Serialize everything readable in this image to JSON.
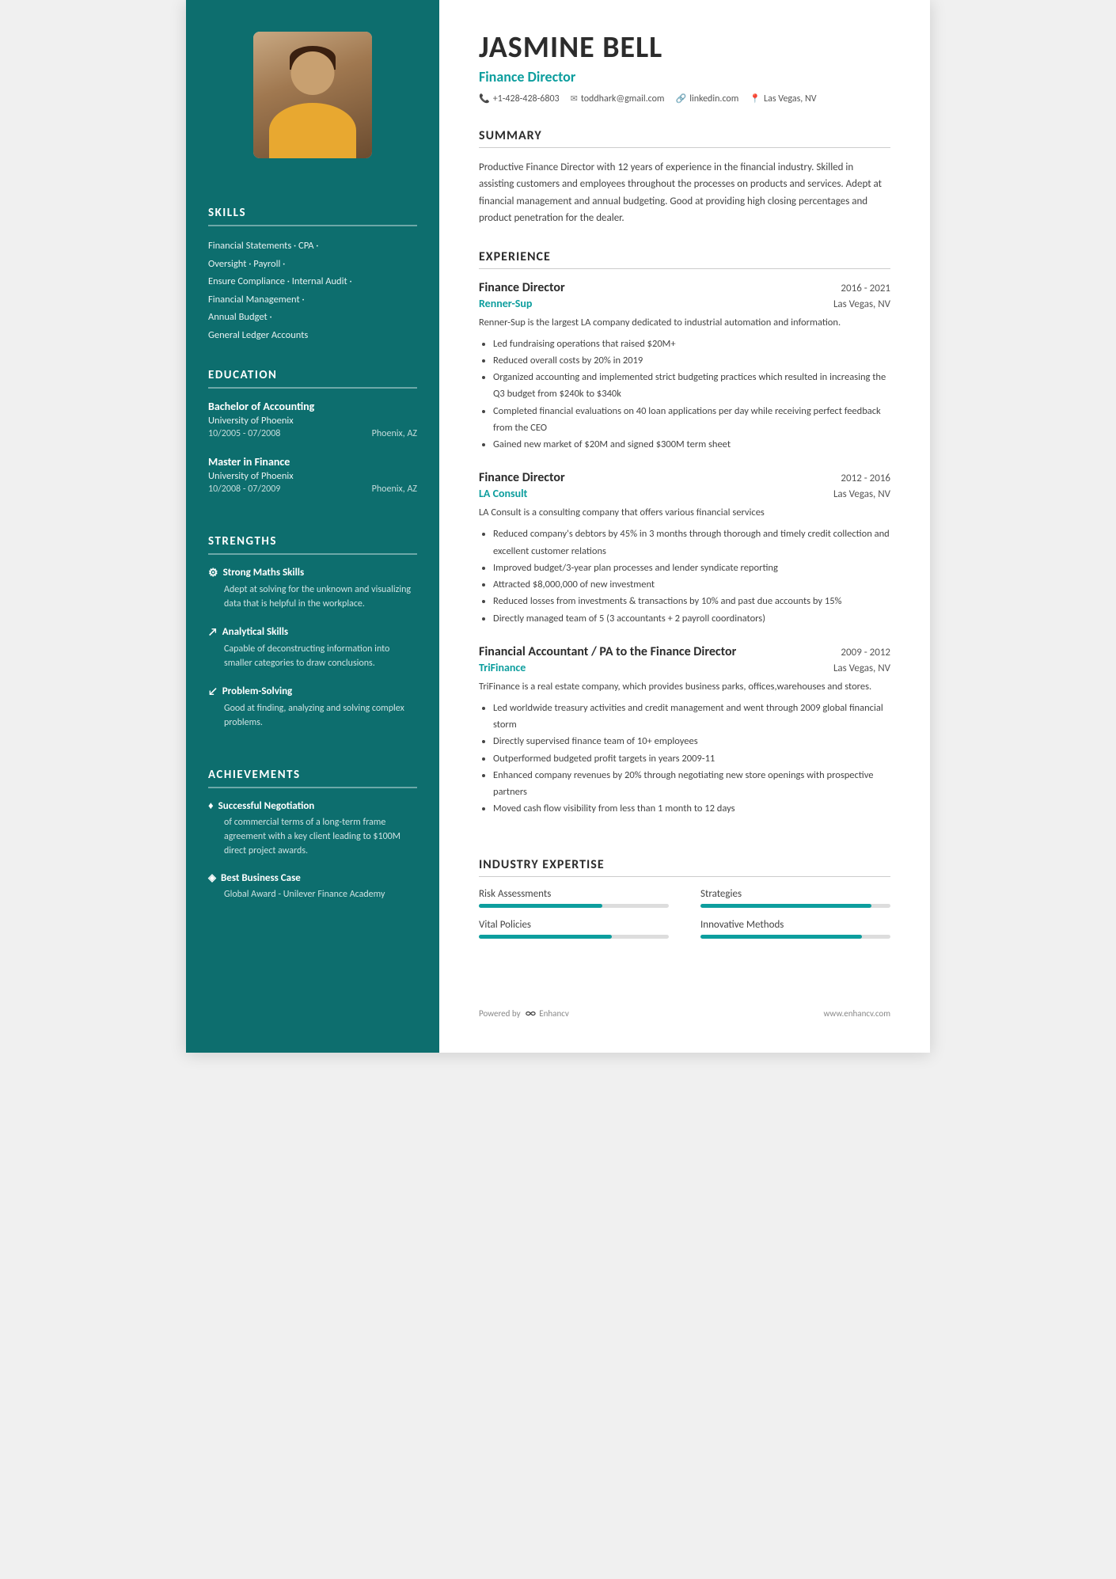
{
  "sidebar": {
    "skills_title": "SKILLS",
    "skills": [
      "Financial Statements · CPA ·",
      "Oversight · Payroll ·",
      "Ensure Compliance · Internal Audit ·",
      "Financial Management ·",
      "Annual Budget ·",
      "General Ledger Accounts"
    ],
    "education_title": "EDUCATION",
    "education": [
      {
        "degree": "Bachelor of Accounting",
        "school": "University of Phoenix",
        "dates": "10/2005 - 07/2008",
        "location": "Phoenix, AZ"
      },
      {
        "degree": "Master in Finance",
        "school": "University of Phoenix",
        "dates": "10/2008 - 07/2009",
        "location": "Phoenix, AZ"
      }
    ],
    "strengths_title": "STRENGTHS",
    "strengths": [
      {
        "icon": "⚙",
        "title": "Strong Maths Skills",
        "desc": "Adept at solving for the unknown and visualizing data that is helpful in the workplace."
      },
      {
        "icon": "↗",
        "title": "Analytical Skills",
        "desc": "Capable of deconstructing information into smaller categories to draw conclusions."
      },
      {
        "icon": "↙",
        "title": "Problem-Solving",
        "desc": "Good at finding, analyzing and solving complex problems."
      }
    ],
    "achievements_title": "ACHIEVEMENTS",
    "achievements": [
      {
        "icon": "♦",
        "title": "Successful Negotiation",
        "desc": "of commercial terms of a long-term frame agreement with a key client leading to $100M direct project awards."
      },
      {
        "icon": "◈",
        "title": "Best Business Case",
        "desc": "Global Award - Unilever Finance Academy"
      }
    ]
  },
  "header": {
    "name": "JASMINE BELL",
    "title": "Finance Director",
    "phone": "+1-428-428-6803",
    "email": "toddhark@gmail.com",
    "linkedin": "linkedin.com",
    "location": "Las Vegas, NV"
  },
  "summary": {
    "title": "SUMMARY",
    "text": "Productive Finance Director with 12 years of experience in the financial industry. Skilled in assisting customers and employees throughout the processes on products and services. Adept at financial management and annual budgeting. Good at providing high closing percentages and product penetration for the dealer."
  },
  "experience": {
    "title": "EXPERIENCE",
    "entries": [
      {
        "job_title": "Finance Director",
        "dates": "2016 - 2021",
        "company": "Renner-Sup",
        "location": "Las Vegas, NV",
        "desc": "Renner-Sup is the largest LA company dedicated to industrial automation and information.",
        "bullets": [
          "Led fundraising operations that raised $20M+",
          "Reduced overall costs by 20% in 2019",
          "Organized accounting and implemented strict budgeting practices which resulted in increasing the Q3 budget from $240k to $340k",
          "Completed financial evaluations on 40 loan applications per day while receiving perfect feedback from the CEO",
          "Gained new market of $20M and signed $300M term sheet"
        ]
      },
      {
        "job_title": "Finance Director",
        "dates": "2012 - 2016",
        "company": "LA Consult",
        "location": "Las Vegas, NV",
        "desc": "LA Consult is a consulting company that offers various financial services",
        "bullets": [
          "Reduced company's debtors by 45% in 3 months through thorough and timely credit collection and excellent customer relations",
          "Improved budget/3-year plan processes and lender syndicate reporting",
          "Attracted $8,000,000 of new investment",
          "Reduced losses from investments & transactions by 10% and past due accounts by 15%",
          "Directly managed team of 5 (3 accountants + 2 payroll coordinators)"
        ]
      },
      {
        "job_title": "Financial Accountant / PA to the Finance Director",
        "dates": "2009 - 2012",
        "company": "TriFinance",
        "location": "Las Vegas, NV",
        "desc": "TriFinance is a real estate company, which provides business parks, offices,warehouses and stores.",
        "bullets": [
          "Led worldwide treasury activities and credit management and went through 2009 global financial storm",
          "Directly supervised finance team of 10+ employees",
          "Outperformed budgeted profit targets in years 2009-11",
          "Enhanced company revenues by 20% through negotiating new store openings with prospective partners",
          "Moved cash flow visibility from less than 1 month to 12 days"
        ]
      }
    ]
  },
  "expertise": {
    "title": "INDUSTRY EXPERTISE",
    "items": [
      {
        "label": "Risk Assessments",
        "pct": 65
      },
      {
        "label": "Strategies",
        "pct": 90
      },
      {
        "label": "Vital Policies",
        "pct": 70
      },
      {
        "label": "Innovative Methods",
        "pct": 85
      }
    ]
  },
  "footer": {
    "powered_by": "Powered by",
    "brand": "Enhancv",
    "website": "www.enhancv.com"
  }
}
